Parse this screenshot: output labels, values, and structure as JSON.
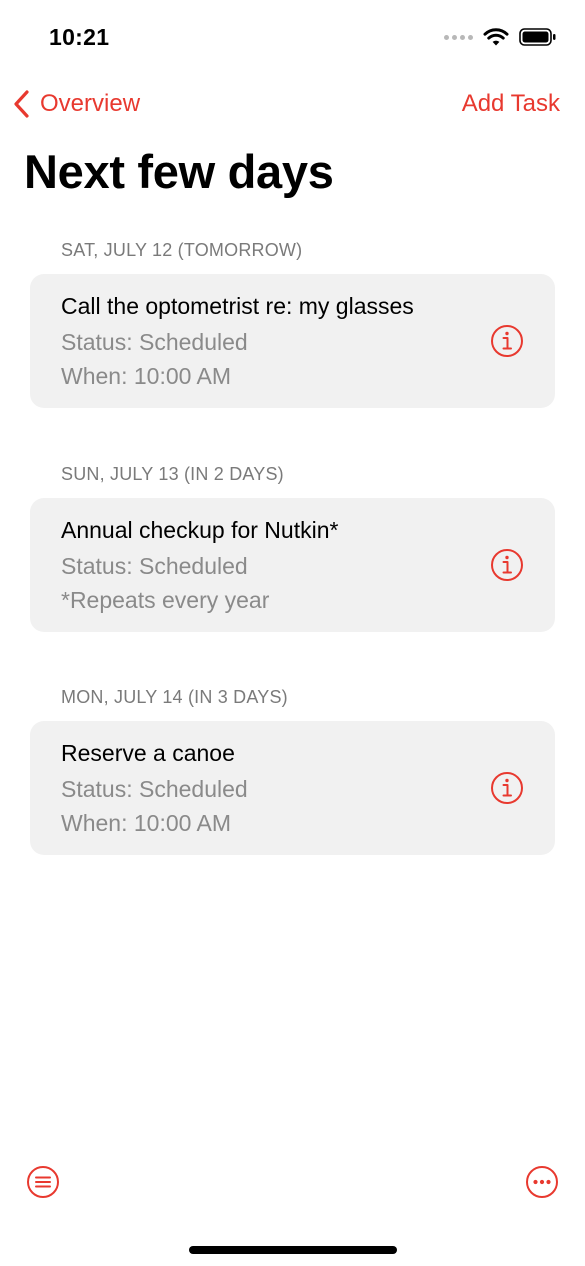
{
  "status_bar": {
    "time": "10:21"
  },
  "nav": {
    "back_label": "Overview",
    "action_label": "Add Task"
  },
  "page_title": "Next few days",
  "sections": [
    {
      "header": "SAT, JULY 12 (TOMORROW)",
      "task": {
        "title": "Call the optometrist re: my glasses",
        "status": "Status: Scheduled",
        "detail": "When: 10:00 AM"
      }
    },
    {
      "header": "SUN, JULY 13 (IN 2 DAYS)",
      "task": {
        "title": "Annual checkup for Nutkin*",
        "status": "Status: Scheduled",
        "detail": "*Repeats every year"
      }
    },
    {
      "header": "MON, JULY 14 (IN 3 DAYS)",
      "task": {
        "title": "Reserve a canoe",
        "status": "Status: Scheduled",
        "detail": "When: 10:00 AM"
      }
    }
  ],
  "toolbar": {
    "left_icon": "list-bullet-icon",
    "right_icon": "more-ellipsis-icon"
  },
  "colors": {
    "accent": "#e8392f",
    "card_background": "#f1f1f1",
    "secondary_text": "#8a8a8a"
  }
}
